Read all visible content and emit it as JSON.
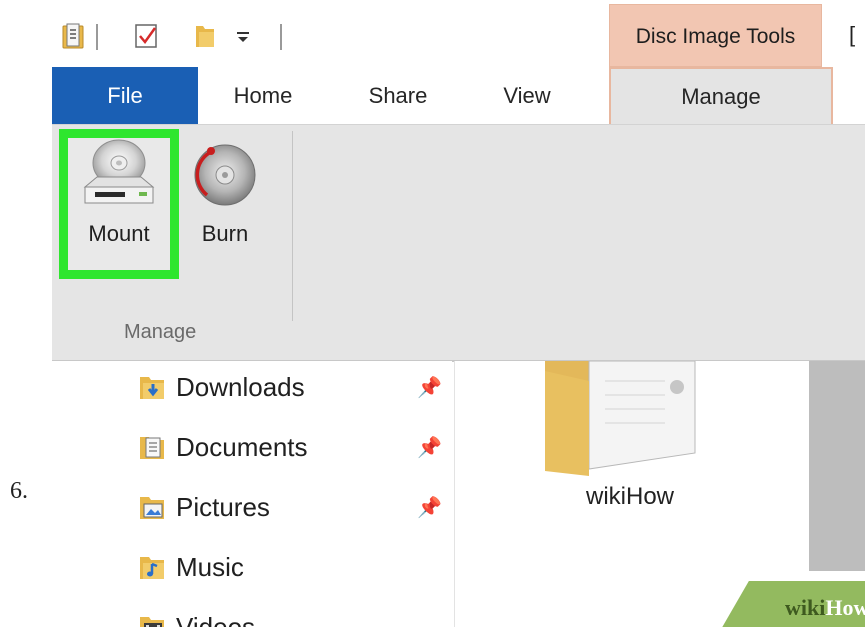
{
  "step": {
    "number": "6."
  },
  "titlebar": {
    "contextual_tab": "Disc Image Tools",
    "qat_icons": [
      "properties-icon",
      "checkmark-icon",
      "new-folder-icon",
      "customize-dropdown-icon"
    ]
  },
  "tabs": [
    {
      "label": "File"
    },
    {
      "label": "Home"
    },
    {
      "label": "Share"
    },
    {
      "label": "View"
    },
    {
      "label": "Manage"
    }
  ],
  "ribbon": {
    "buttons": [
      {
        "label": "Mount",
        "icon": "disc-drive-icon",
        "highlighted": true
      },
      {
        "label": "Burn",
        "icon": "burn-disc-icon",
        "highlighted": false
      }
    ],
    "group_label": "Manage",
    "highlight_color": "#2ee62e"
  },
  "nav": {
    "items": [
      {
        "label": "Downloads",
        "icon": "downloads-folder-icon",
        "pinned": true
      },
      {
        "label": "Documents",
        "icon": "documents-folder-icon",
        "pinned": true
      },
      {
        "label": "Pictures",
        "icon": "pictures-folder-icon",
        "pinned": true
      },
      {
        "label": "Music",
        "icon": "music-folder-icon",
        "pinned": false
      },
      {
        "label": "Videos",
        "icon": "videos-folder-icon",
        "pinned": false
      }
    ]
  },
  "content": {
    "folder_name": "wikiHow"
  },
  "watermark": {
    "wiki": "wiki",
    "how": "How"
  },
  "colors": {
    "file_tab": "#1a5fb4",
    "contextual_tab": "#f2c6b2",
    "ribbon_bg": "#e5e5e5",
    "watermark_green": "#93ba5f"
  }
}
